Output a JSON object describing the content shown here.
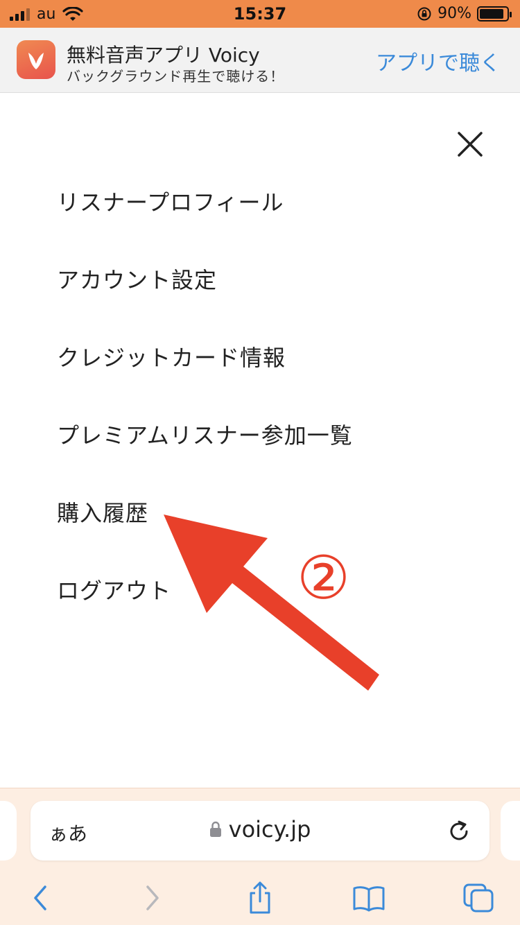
{
  "status_bar": {
    "carrier": "au",
    "time": "15:37",
    "battery_text": "90%",
    "battery_level": 0.9,
    "icons": [
      "signal-icon",
      "wifi-icon",
      "rotation-lock-icon",
      "battery-icon"
    ]
  },
  "app_banner": {
    "title": "無料音声アプリ Voicy",
    "subtitle": "バックグラウンド再生で聴ける！",
    "open_label": "アプリで聴く"
  },
  "menu": {
    "items": [
      {
        "label": "リスナープロフィール"
      },
      {
        "label": "アカウント設定"
      },
      {
        "label": "クレジットカード情報"
      },
      {
        "label": "プレミアムリスナー参加一覧"
      },
      {
        "label": "購入履歴"
      },
      {
        "label": "ログアウト"
      }
    ]
  },
  "annotation": {
    "number": "②",
    "color": "#e8402a"
  },
  "browser": {
    "aa_label": "ぁあ",
    "url": "voicy.jp",
    "accent": "#3b8ad9"
  }
}
